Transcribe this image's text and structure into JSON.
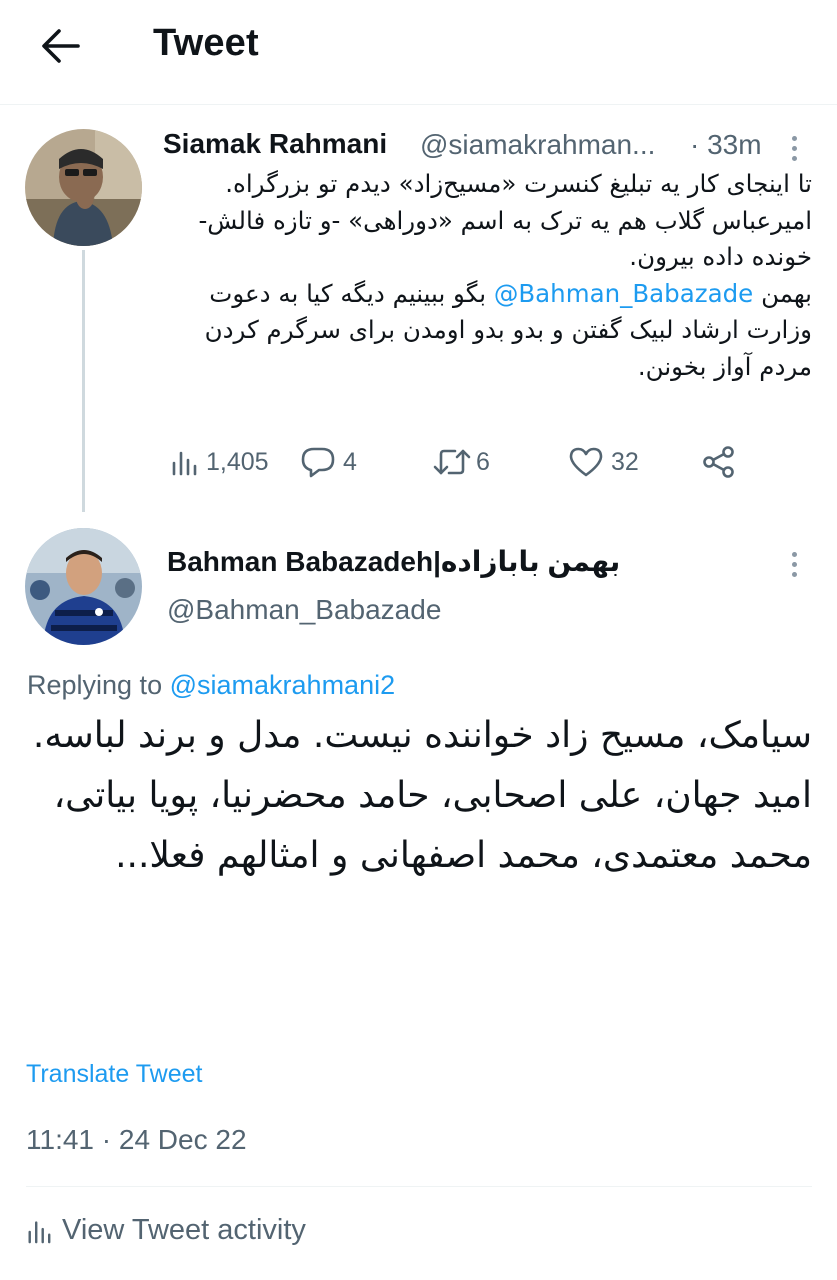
{
  "header": {
    "title": "Tweet",
    "back_icon": "arrow-left-icon"
  },
  "parent_tweet": {
    "author_name": "Siamak Rahmani",
    "handle": "@siamakrahman...",
    "separator": "·",
    "time": "33m",
    "text_lines": [
      "تا اینجای کار یه تبلیغ کنسرت «مسیح‌زاد» دیدم تو بزرگراه. امیرعباس گلاب هم یه ترک به اسم «دوراهی» -و تازه فالش- خونده داده بیرون.",
      "بهمن",
      "@Bahman_Babazade",
      "بگو ببینیم دیگه کیا به دعوت وزارت ارشاد لبیک گفتن و بدو بدو اومدن برای سرگرم کردن مردم آواز بخونن."
    ],
    "stats": {
      "views": "1,405",
      "replies": "4",
      "retweets": "6",
      "likes": "32"
    }
  },
  "reply_tweet": {
    "author_name": "Bahman Babazadeh|بهمن بابازاده",
    "handle": "@Bahman_Babazade",
    "replying_prefix": "Replying to",
    "replying_to": "@siamakrahmani2",
    "text_lines": [
      "سیامک، مسیح زاد خواننده نیست. مدل و برند لباسه.",
      "امید جهان، علی اصحابی، حامد محضرنیا، پویا بیاتی، محمد معتمدی، محمد اصفهانی و امثالهم فعلا..."
    ],
    "translate_label": "Translate Tweet",
    "timestamp": "11:41 · 24 Dec 22",
    "activity_label": "View Tweet activity"
  },
  "colors": {
    "accent": "#1d9bf0",
    "secondary_text": "#536471",
    "primary_text": "#0f1419",
    "thread_line": "#cfd9de"
  }
}
